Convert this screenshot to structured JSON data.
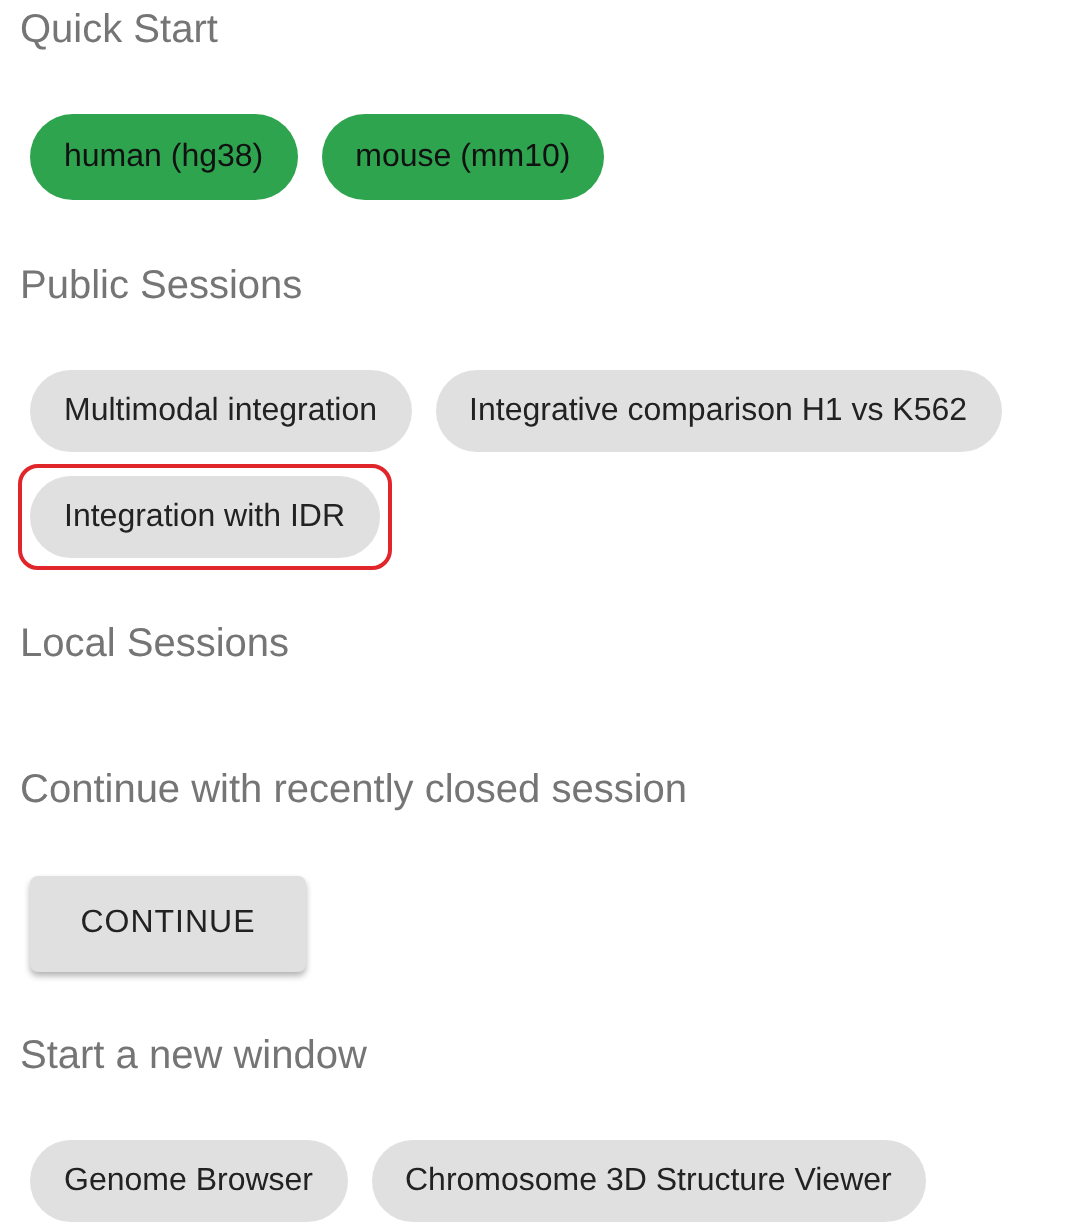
{
  "sections": [
    {
      "title": "Quick Start",
      "kind": "chips",
      "items": [
        {
          "label": "human (hg38)",
          "kind": "genome",
          "highlighted": false
        },
        {
          "label": "mouse (mm10)",
          "kind": "genome",
          "highlighted": false
        }
      ]
    },
    {
      "title": "Public Sessions",
      "kind": "chips",
      "items": [
        {
          "label": "Multimodal integration",
          "kind": "session",
          "highlighted": false
        },
        {
          "label": "Integrative comparison H1 vs K562",
          "kind": "session",
          "highlighted": false
        },
        {
          "label": "Integration with IDR",
          "kind": "session",
          "highlighted": true
        }
      ]
    },
    {
      "title": "Local Sessions",
      "kind": "empty"
    },
    {
      "title": "Continue with recently closed session",
      "kind": "button",
      "button": "CONTINUE"
    },
    {
      "title": "Start a new window",
      "kind": "chips",
      "items": [
        {
          "label": "Genome Browser",
          "kind": "session",
          "highlighted": false
        },
        {
          "label": "Chromosome 3D Structure Viewer",
          "kind": "session",
          "highlighted": false
        }
      ]
    }
  ]
}
